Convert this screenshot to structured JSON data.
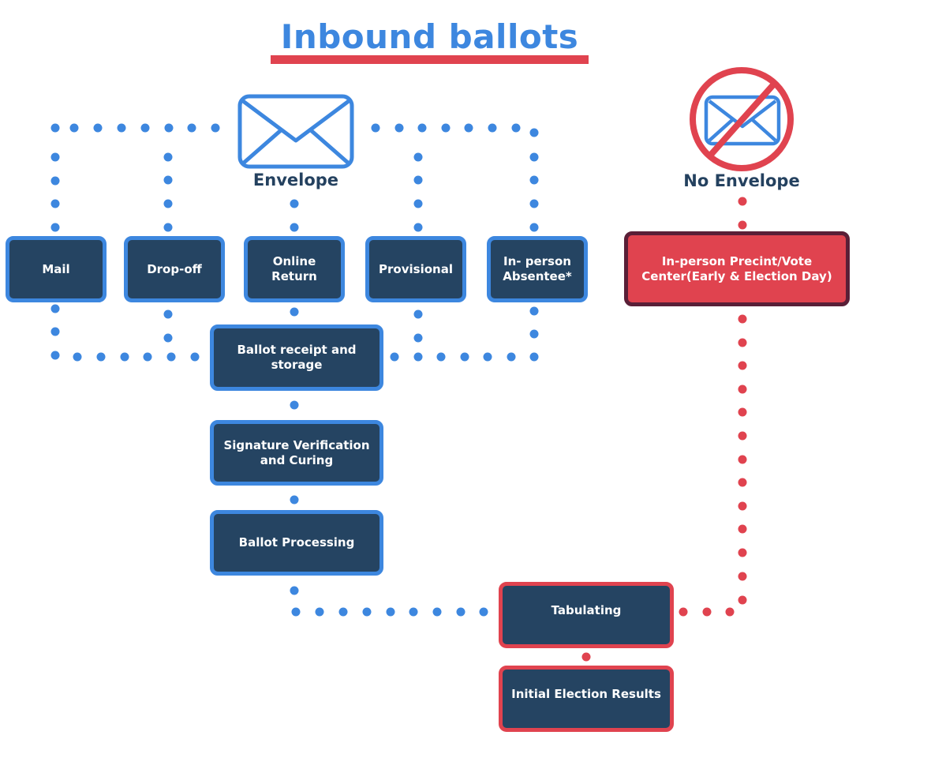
{
  "title": "Inbound ballots",
  "colors": {
    "accent_blue": "#3d87df",
    "accent_red": "#e0434f",
    "box_navy": "#254462",
    "box_dark_border": "#5a1f37",
    "label_navy": "#24415f"
  },
  "icons": {
    "envelope": "envelope-icon",
    "no_envelope": "no-envelope-icon"
  },
  "categories": {
    "envelope": "Envelope",
    "no_envelope": "No Envelope"
  },
  "nodes": {
    "mail": "Mail",
    "drop_off": "Drop-off",
    "online_return": "Online Return",
    "provisional": "Provisional",
    "in_person_absentee": "In- person Absentee*",
    "in_person_precinct": "In-person Precint/Vote Center(Early & Election Day)",
    "ballot_receipt": "Ballot receipt and storage",
    "signature_verification": "Signature Verification and Curing",
    "ballot_processing": "Ballot Processing",
    "tabulating": "Tabulating",
    "initial_results": "Initial Election Results"
  },
  "edges": [
    {
      "from": "envelope",
      "to": "mail",
      "style": "blue-dotted"
    },
    {
      "from": "envelope",
      "to": "drop_off",
      "style": "blue-dotted"
    },
    {
      "from": "envelope",
      "to": "online_return",
      "style": "blue-dotted"
    },
    {
      "from": "envelope",
      "to": "provisional",
      "style": "blue-dotted"
    },
    {
      "from": "envelope",
      "to": "in_person_absentee",
      "style": "blue-dotted"
    },
    {
      "from": "mail",
      "to": "ballot_receipt",
      "style": "blue-dotted"
    },
    {
      "from": "drop_off",
      "to": "ballot_receipt",
      "style": "blue-dotted"
    },
    {
      "from": "online_return",
      "to": "ballot_receipt",
      "style": "blue-dotted"
    },
    {
      "from": "provisional",
      "to": "ballot_receipt",
      "style": "blue-dotted"
    },
    {
      "from": "in_person_absentee",
      "to": "ballot_receipt",
      "style": "blue-dotted"
    },
    {
      "from": "ballot_receipt",
      "to": "signature_verification",
      "style": "blue-dotted"
    },
    {
      "from": "signature_verification",
      "to": "ballot_processing",
      "style": "blue-dotted"
    },
    {
      "from": "ballot_processing",
      "to": "tabulating",
      "style": "blue-dotted"
    },
    {
      "from": "no_envelope",
      "to": "in_person_precinct",
      "style": "red-dotted"
    },
    {
      "from": "in_person_precinct",
      "to": "tabulating",
      "style": "red-dotted"
    },
    {
      "from": "tabulating",
      "to": "initial_results",
      "style": "red-dotted"
    }
  ]
}
